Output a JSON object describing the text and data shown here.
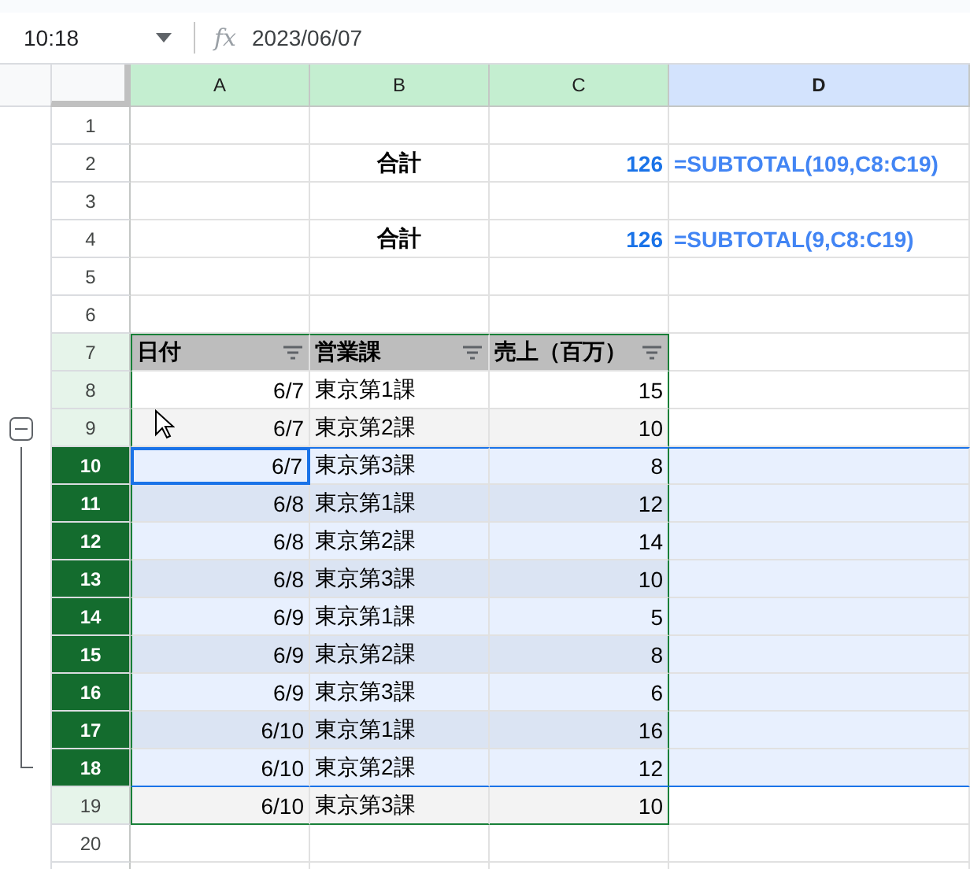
{
  "name_box": {
    "value": "10:18"
  },
  "formula_bar": {
    "fx_label": "fx",
    "value": "2023/06/07"
  },
  "group": {
    "expanded": true
  },
  "columns": [
    {
      "label": "A",
      "selected": true,
      "in_table": true
    },
    {
      "label": "B",
      "selected": true,
      "in_table": true
    },
    {
      "label": "C",
      "selected": true,
      "in_table": true
    },
    {
      "label": "D",
      "selected": true,
      "in_table": false
    }
  ],
  "rows": [
    {
      "number": "1",
      "kind": "plain",
      "selected": false,
      "cells": [
        "",
        "",
        "",
        ""
      ]
    },
    {
      "number": "2",
      "kind": "summary",
      "selected": false,
      "cells": [
        "",
        "合計",
        "126",
        "=SUBTOTAL(109,C8:C19)"
      ]
    },
    {
      "number": "3",
      "kind": "plain",
      "selected": false,
      "cells": [
        "",
        "",
        "",
        ""
      ]
    },
    {
      "number": "4",
      "kind": "summary",
      "selected": false,
      "cells": [
        "",
        "合計",
        "126",
        "=SUBTOTAL(9,C8:C19)"
      ]
    },
    {
      "number": "5",
      "kind": "plain",
      "selected": false,
      "cells": [
        "",
        "",
        "",
        ""
      ]
    },
    {
      "number": "6",
      "kind": "plain",
      "selected": false,
      "cells": [
        "",
        "",
        "",
        ""
      ]
    },
    {
      "number": "7",
      "kind": "table-header",
      "selected": false,
      "cells": [
        "日付",
        "営業課",
        "売上（百万）",
        ""
      ]
    },
    {
      "number": "8",
      "kind": "table-row",
      "selected": false,
      "cells": [
        "6/7",
        "東京第1課",
        "15",
        ""
      ]
    },
    {
      "number": "9",
      "kind": "table-row",
      "selected": false,
      "cells": [
        "6/7",
        "東京第2課",
        "10",
        ""
      ]
    },
    {
      "number": "10",
      "kind": "table-row",
      "selected": true,
      "active": true,
      "grouped": true,
      "cells": [
        "6/7",
        "東京第3課",
        "8",
        ""
      ]
    },
    {
      "number": "11",
      "kind": "table-row",
      "selected": true,
      "grouped": true,
      "cells": [
        "6/8",
        "東京第1課",
        "12",
        ""
      ]
    },
    {
      "number": "12",
      "kind": "table-row",
      "selected": true,
      "grouped": true,
      "cells": [
        "6/8",
        "東京第2課",
        "14",
        ""
      ]
    },
    {
      "number": "13",
      "kind": "table-row",
      "selected": true,
      "grouped": true,
      "cells": [
        "6/8",
        "東京第3課",
        "10",
        ""
      ]
    },
    {
      "number": "14",
      "kind": "table-row",
      "selected": true,
      "grouped": true,
      "cells": [
        "6/9",
        "東京第1課",
        "5",
        ""
      ]
    },
    {
      "number": "15",
      "kind": "table-row",
      "selected": true,
      "grouped": true,
      "cells": [
        "6/9",
        "東京第2課",
        "8",
        ""
      ]
    },
    {
      "number": "16",
      "kind": "table-row",
      "selected": true,
      "grouped": true,
      "cells": [
        "6/9",
        "東京第3課",
        "6",
        ""
      ]
    },
    {
      "number": "17",
      "kind": "table-row",
      "selected": true,
      "grouped": true,
      "cells": [
        "6/10",
        "東京第1課",
        "16",
        ""
      ]
    },
    {
      "number": "18",
      "kind": "table-row",
      "selected": true,
      "grouped": true,
      "cells": [
        "6/10",
        "東京第2課",
        "12",
        ""
      ]
    },
    {
      "number": "19",
      "kind": "table-row",
      "selected": false,
      "cells": [
        "6/10",
        "東京第3課",
        "10",
        ""
      ]
    },
    {
      "number": "20",
      "kind": "plain",
      "selected": false,
      "cells": [
        "",
        "",
        "",
        ""
      ]
    }
  ]
}
